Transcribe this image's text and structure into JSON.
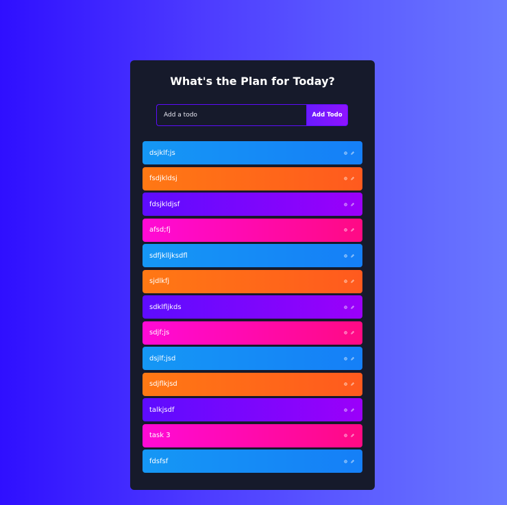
{
  "header": {
    "title": "What's the Plan for Today?"
  },
  "form": {
    "input_placeholder": "Add a todo",
    "input_value": "",
    "add_button_label": "Add Todo"
  },
  "todos": [
    {
      "text": "dsjklf;js",
      "color": "#1597f5"
    },
    {
      "text": "fsdjkldsj",
      "color": "#ff7814"
    },
    {
      "text": "fdsjkldjsf",
      "color": "#5d0cff"
    },
    {
      "text": "afsd;fj",
      "color": "#ff0ad6"
    },
    {
      "text": "sdfjklljksdfl",
      "color": "#1597f5"
    },
    {
      "text": "sjdlkfj",
      "color": "#ff7814"
    },
    {
      "text": "sdklfljkds",
      "color": "#5d0cff"
    },
    {
      "text": "sdjf;js",
      "color": "#ff0ad6"
    },
    {
      "text": "dsjlf;jsd",
      "color": "#1597f5"
    },
    {
      "text": "sdjflkjsd",
      "color": "#ff7814"
    },
    {
      "text": "talkjsdf",
      "color": "#5d0cff"
    },
    {
      "text": "task 3",
      "color": "#ff0ad6"
    },
    {
      "text": "fdsfsf",
      "color": "#1597f5"
    }
  ],
  "icons": {
    "delete": "close-icon",
    "edit": "edit-icon"
  },
  "colors": {
    "panel_bg": "#161a2b",
    "accent": "#5d0cff",
    "text": "#ffffff"
  }
}
